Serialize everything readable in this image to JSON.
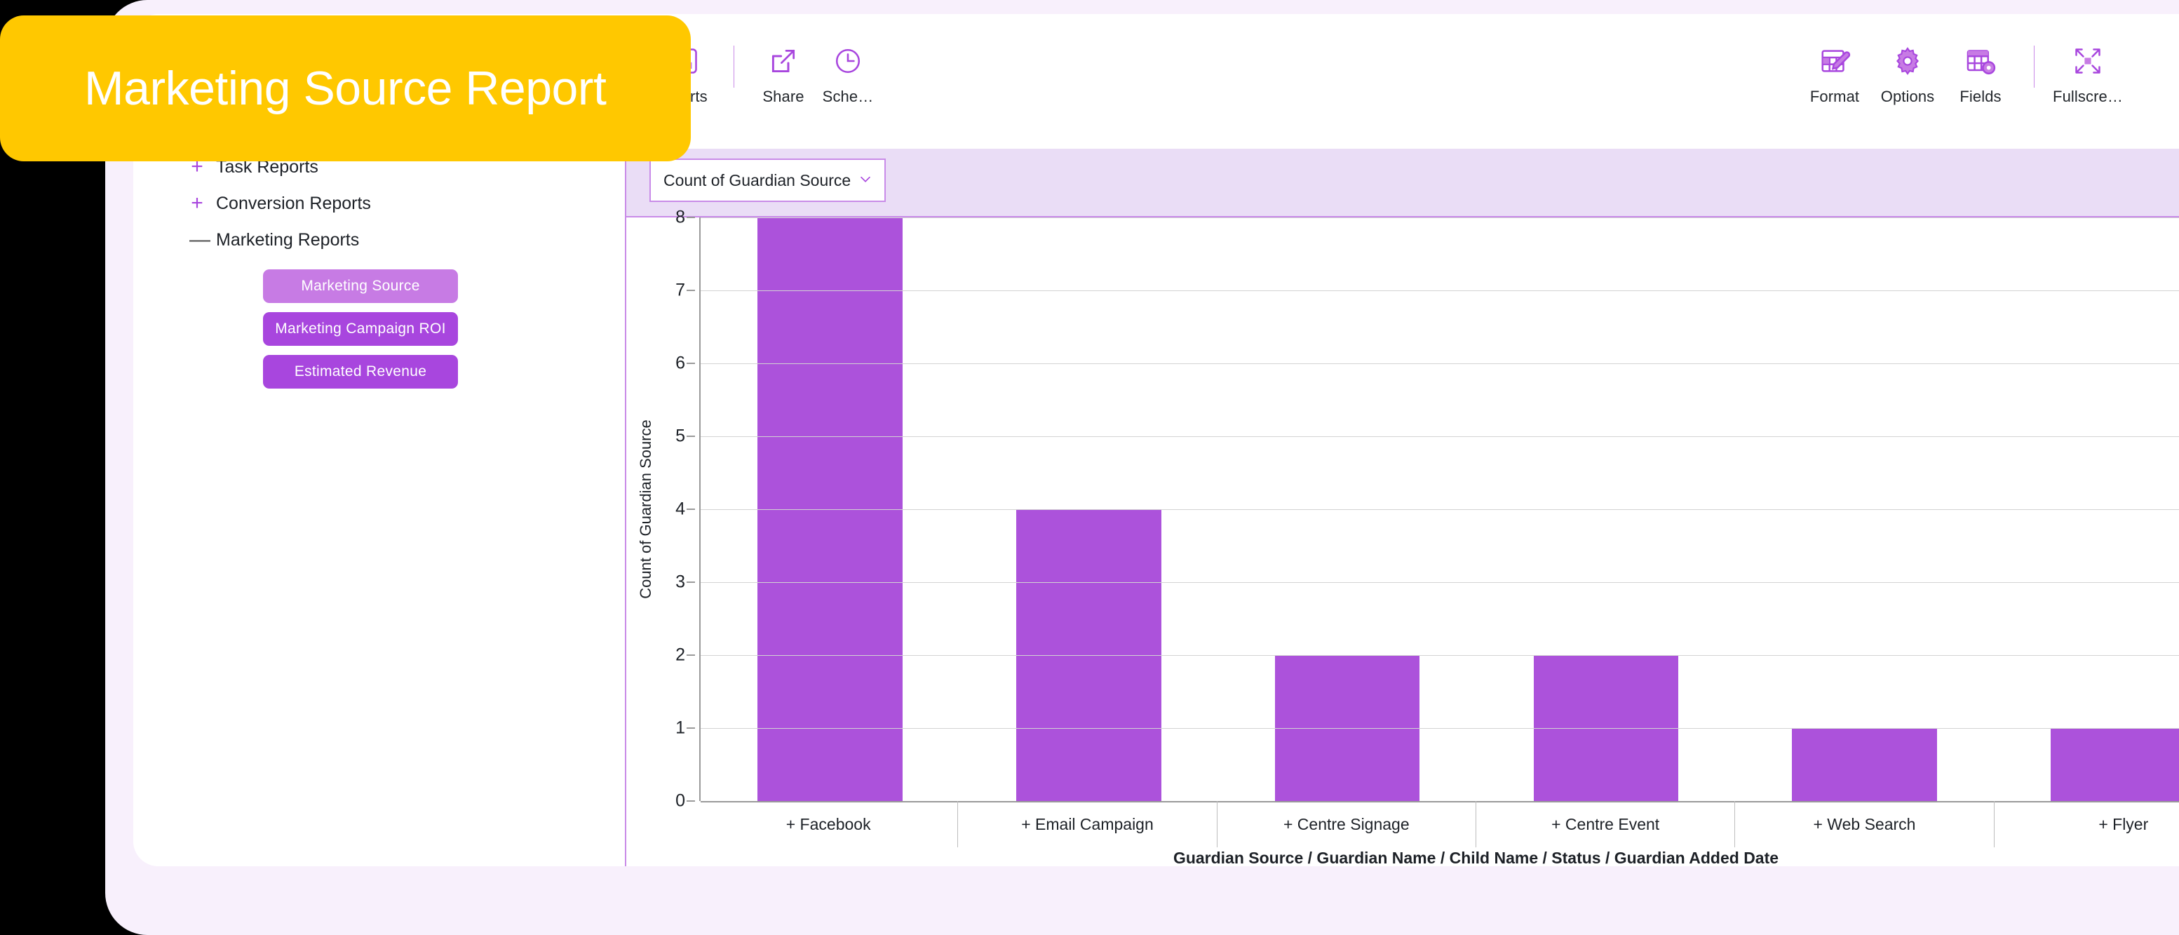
{
  "banner": {
    "title": "Marketing Source Report",
    "bg_color": "#FFC800",
    "text_color": "#FFFFFF"
  },
  "theme": {
    "accent": "#A846DE",
    "accent_light": "#C77BE4",
    "bar_color": "#AC52DB",
    "panel_header_bg": "#EADDF6",
    "border": "#C98BE8",
    "frame_bg": "#F8F0FC"
  },
  "toolbar": {
    "left_tools": [
      {
        "label": "Charts",
        "icon": "bar-chart-icon"
      },
      {
        "label": "Share",
        "icon": "share-icon"
      },
      {
        "label": "Sche…",
        "icon": "clock-icon"
      }
    ],
    "right_tools": [
      {
        "label": "Format",
        "icon": "format-table-pencil-icon"
      },
      {
        "label": "Options",
        "icon": "gear-icon"
      },
      {
        "label": "Fields",
        "icon": "table-gear-icon"
      },
      {
        "label": "Fullscre…",
        "icon": "fullscreen-expand-icon"
      }
    ]
  },
  "sidebar": {
    "tree": [
      {
        "label": "Task Reports",
        "toggle": "+",
        "expanded": false
      },
      {
        "label": "Conversion Reports",
        "toggle": "+",
        "expanded": false
      },
      {
        "label": "Marketing Reports",
        "toggle": "—",
        "expanded": true
      }
    ],
    "report_buttons": [
      {
        "label": "Marketing Source",
        "active": true
      },
      {
        "label": "Marketing Campaign ROI",
        "active": false
      },
      {
        "label": "Estimated Revenue",
        "active": false
      }
    ]
  },
  "chart_panel": {
    "measure_select": {
      "value": "Count of Guardian Source",
      "icon": "chevron-down-icon"
    },
    "collapse_button": {
      "icon": "collapse-arrow-down-left-icon"
    }
  },
  "chart_data": {
    "type": "bar",
    "title": "",
    "categories": [
      "+ Facebook",
      "+ Email Campaign",
      "+ Centre Signage",
      "+ Centre Event",
      "+ Web Search",
      "+ Flyer"
    ],
    "values": [
      8,
      4,
      2,
      2,
      1,
      1
    ],
    "series": [
      {
        "name": "Count of Guardian Source",
        "values": [
          8,
          4,
          2,
          2,
          1,
          1
        ]
      }
    ],
    "xlabel": "Guardian Source / Guardian Name / Child Name / Status / Guardian Added Date",
    "ylabel": "Count of Guardian Source",
    "ylim": [
      0,
      8
    ],
    "yticks": [
      0,
      1,
      2,
      3,
      4,
      5,
      6,
      7,
      8
    ],
    "ytick_labels": [
      "0",
      "1",
      "2",
      "3",
      "4",
      "5",
      "6",
      "7",
      "8"
    ],
    "grid": true,
    "legend": false,
    "bar_color": "#AC52DB"
  }
}
